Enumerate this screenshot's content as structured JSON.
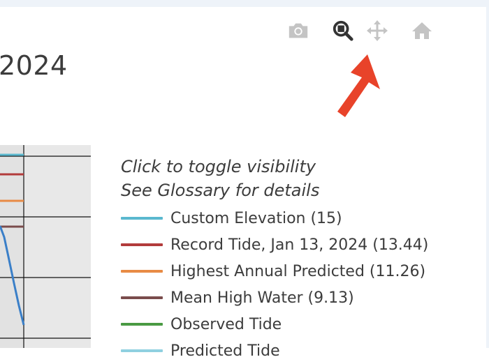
{
  "title_fragment": "2024",
  "modebar": {
    "buttons": [
      {
        "name": "camera-icon",
        "color": "#c4c4c4"
      },
      {
        "name": "zoom-icon",
        "color": "#333333"
      },
      {
        "name": "pan-icon",
        "color": "#c4c4c4"
      },
      {
        "name": "home-icon",
        "color": "#c4c4c4"
      }
    ]
  },
  "annotation_arrow_color": "#e8432a",
  "legend": {
    "note_1": "Click to toggle visibility",
    "note_2": "See Glossary for details",
    "items": [
      {
        "label": "Custom Elevation (15)",
        "color": "#5ab8cf"
      },
      {
        "label": "Record Tide, Jan 13, 2024 (13.44)",
        "color": "#b23b3b"
      },
      {
        "label": "Highest Annual Predicted (11.26)",
        "color": "#e88b45"
      },
      {
        "label": "Mean High Water (9.13)",
        "color": "#7a4c4c"
      },
      {
        "label": "Observed Tide",
        "color": "#4a9a43"
      },
      {
        "label": "Predicted Tide",
        "color": "#8fd0e0"
      }
    ]
  },
  "chart_data": {
    "type": "line",
    "series": [
      {
        "name": "Custom Elevation (15)",
        "color": "#5ab8cf",
        "values": [
          15
        ]
      },
      {
        "name": "Record Tide, Jan 13, 2024 (13.44)",
        "color": "#b23b3b",
        "values": [
          13.44
        ]
      },
      {
        "name": "Highest Annual Predicted (11.26)",
        "color": "#e88b45",
        "values": [
          11.26
        ]
      },
      {
        "name": "Mean High Water (9.13)",
        "color": "#7a4c4c",
        "values": [
          9.13
        ]
      },
      {
        "name": "Observed Tide",
        "color": "#4a9a43"
      },
      {
        "name": "Predicted Tide",
        "color": "#8fd0e0"
      }
    ],
    "grid": true
  }
}
